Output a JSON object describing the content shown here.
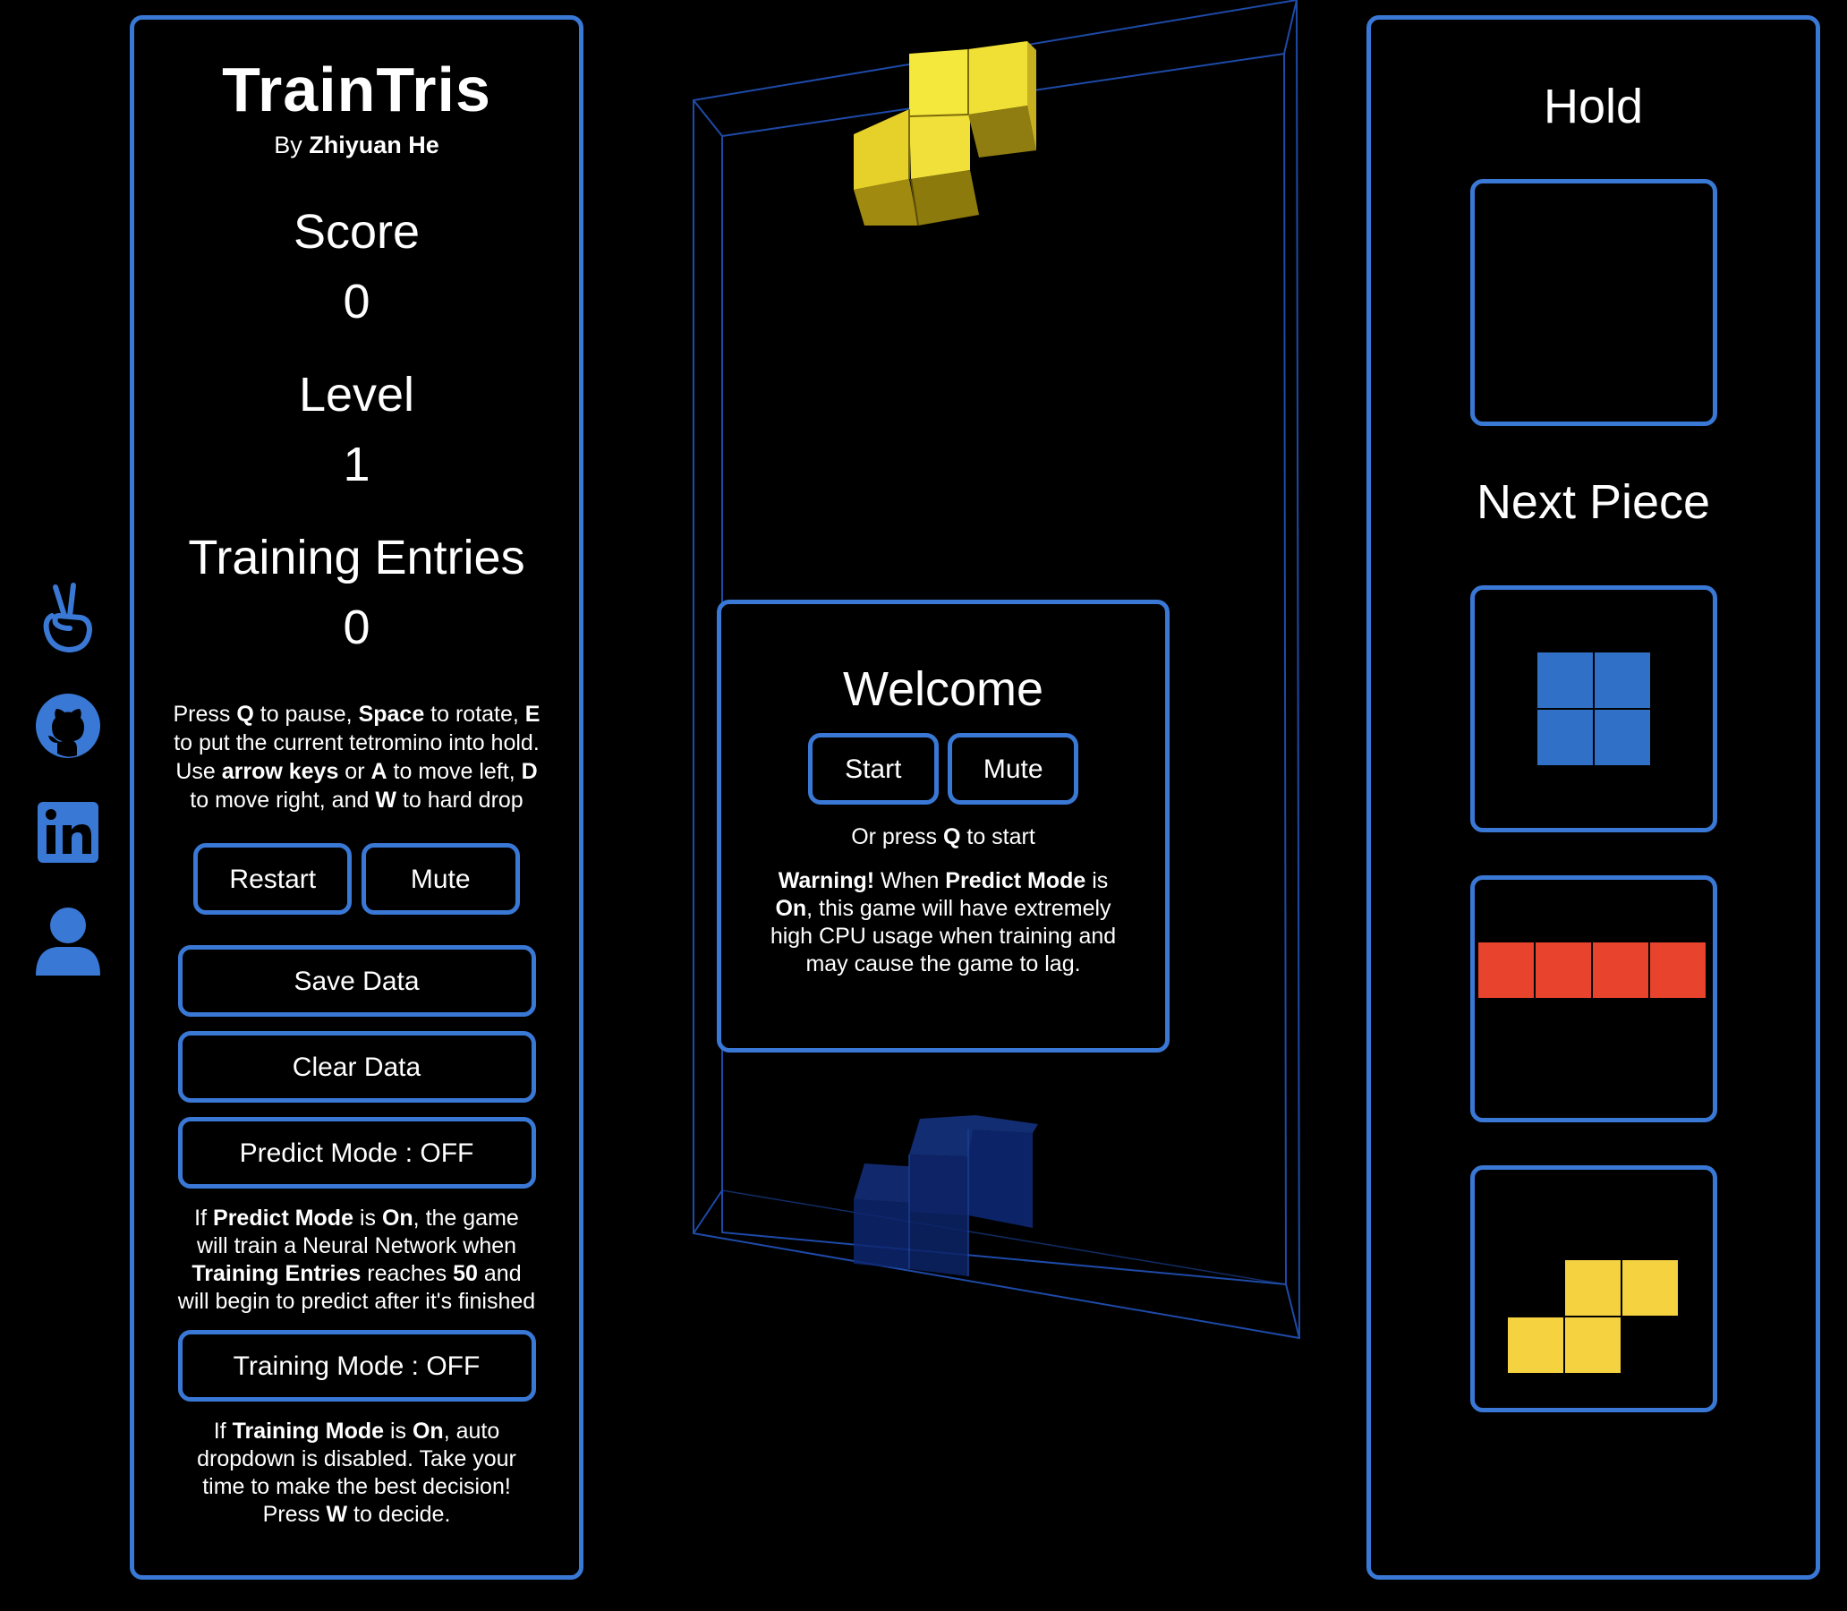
{
  "app": {
    "title": "TrainTris",
    "byline_prefix": "By",
    "author": "Zhiyuan He"
  },
  "social": [
    {
      "name": "angellist-icon"
    },
    {
      "name": "github-icon"
    },
    {
      "name": "linkedin-icon"
    },
    {
      "name": "user-icon"
    }
  ],
  "stats": {
    "score_label": "Score",
    "score_value": "0",
    "level_label": "Level",
    "level_value": "1",
    "entries_label": "Training Entries",
    "entries_value": "0"
  },
  "help": {
    "t1": "Press ",
    "k1": "Q",
    "t2": " to pause, ",
    "k2": "Space",
    "t3": " to rotate, ",
    "k3": "E",
    "t4": " to put the current tetromino into hold. Use ",
    "k4": "arrow keys",
    "t5": " or ",
    "k5": "A",
    "t6": " to move left, ",
    "k6": "D",
    "t7": " to move right, and ",
    "k7": "W",
    "t8": " to hard drop"
  },
  "buttons": {
    "restart": "Restart",
    "mute": "Mute",
    "save": "Save Data",
    "clear": "Clear Data",
    "predict": "Predict Mode : OFF",
    "training": "Training Mode : OFF"
  },
  "predict_help": {
    "t1": "If ",
    "k1": "Predict Mode",
    "t2": " is ",
    "k2": "On",
    "t3": ", the game will train a Neural Network when ",
    "k3": "Training Entries",
    "t4": " reaches ",
    "k4": "50",
    "t5": " and will begin to predict after it's finished"
  },
  "training_help": {
    "t1": "If ",
    "k1": "Training Mode",
    "t2": " is ",
    "k2": "On",
    "t3": ", auto dropdown is disabled. Take your time to make the best decision! Press ",
    "k3": "W",
    "t4": " to decide."
  },
  "modal": {
    "title": "Welcome",
    "start": "Start",
    "mute": "Mute",
    "hint_t1": "Or press ",
    "hint_k": "Q",
    "hint_t2": " to start",
    "warn_k1": "Warning!",
    "warn_t1": " When ",
    "warn_k2": "Predict Mode",
    "warn_t2": " is ",
    "warn_k3": "On",
    "warn_t3": ", this game will have extremely high CPU usage when training and may cause the game to lag."
  },
  "right": {
    "hold_label": "Hold",
    "next_label": "Next Piece",
    "next_pieces": [
      {
        "shape": "O",
        "color": "#3070c6"
      },
      {
        "shape": "I",
        "color": "#e8432c"
      },
      {
        "shape": "S",
        "color": "#f5d23f"
      }
    ]
  },
  "colors": {
    "accent": "#3a78d6",
    "current_piece": "#f5e23a",
    "ghost_piece": "#0f2a7a",
    "background": "#000000"
  }
}
